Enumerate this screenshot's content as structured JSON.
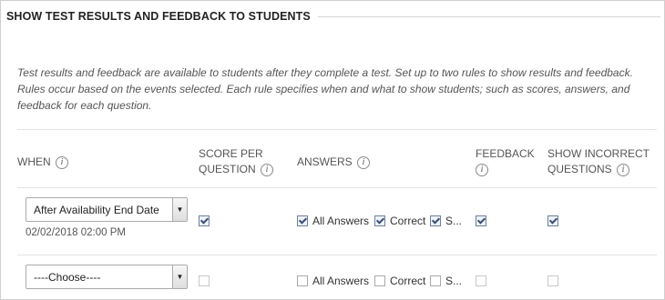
{
  "section": {
    "title": "SHOW TEST RESULTS AND FEEDBACK TO STUDENTS"
  },
  "intro": {
    "line1": "Test results and feedback are available to students after they complete a test. Set up to two rules to show results and feedback.",
    "line2": "Rules occur based on the events selected. Each rule specifies when and what to show students; such as scores, answers, and",
    "line3": "feedback for each question."
  },
  "columns": {
    "when": "WHEN",
    "score_line1": "SCORE PER",
    "score_line2": "QUESTION",
    "answers": "ANSWERS",
    "feedback": "FEEDBACK",
    "incorrect_line1": "SHOW INCORRECT",
    "incorrect_line2": "QUESTIONS",
    "help_glyph": "i"
  },
  "rules": [
    {
      "when_value": "After Availability End Date",
      "date_text": "02/02/2018 02:00 PM",
      "score_per_question": true,
      "all_answers": true,
      "all_answers_label": "All Answers",
      "correct": true,
      "correct_label": "Correct",
      "submitted": true,
      "submitted_label": "S...",
      "feedback": true,
      "show_incorrect": true
    },
    {
      "when_value": "----Choose----",
      "date_text": "",
      "score_per_question": false,
      "all_answers": false,
      "all_answers_label": "All Answers",
      "correct": false,
      "correct_label": "Correct",
      "submitted": false,
      "submitted_label": "S...",
      "feedback": false,
      "show_incorrect": false
    }
  ],
  "icons": {
    "help": "help-info-icon",
    "dropdown": "dropdown-arrow-icon",
    "checkmark": "checkmark-icon"
  }
}
